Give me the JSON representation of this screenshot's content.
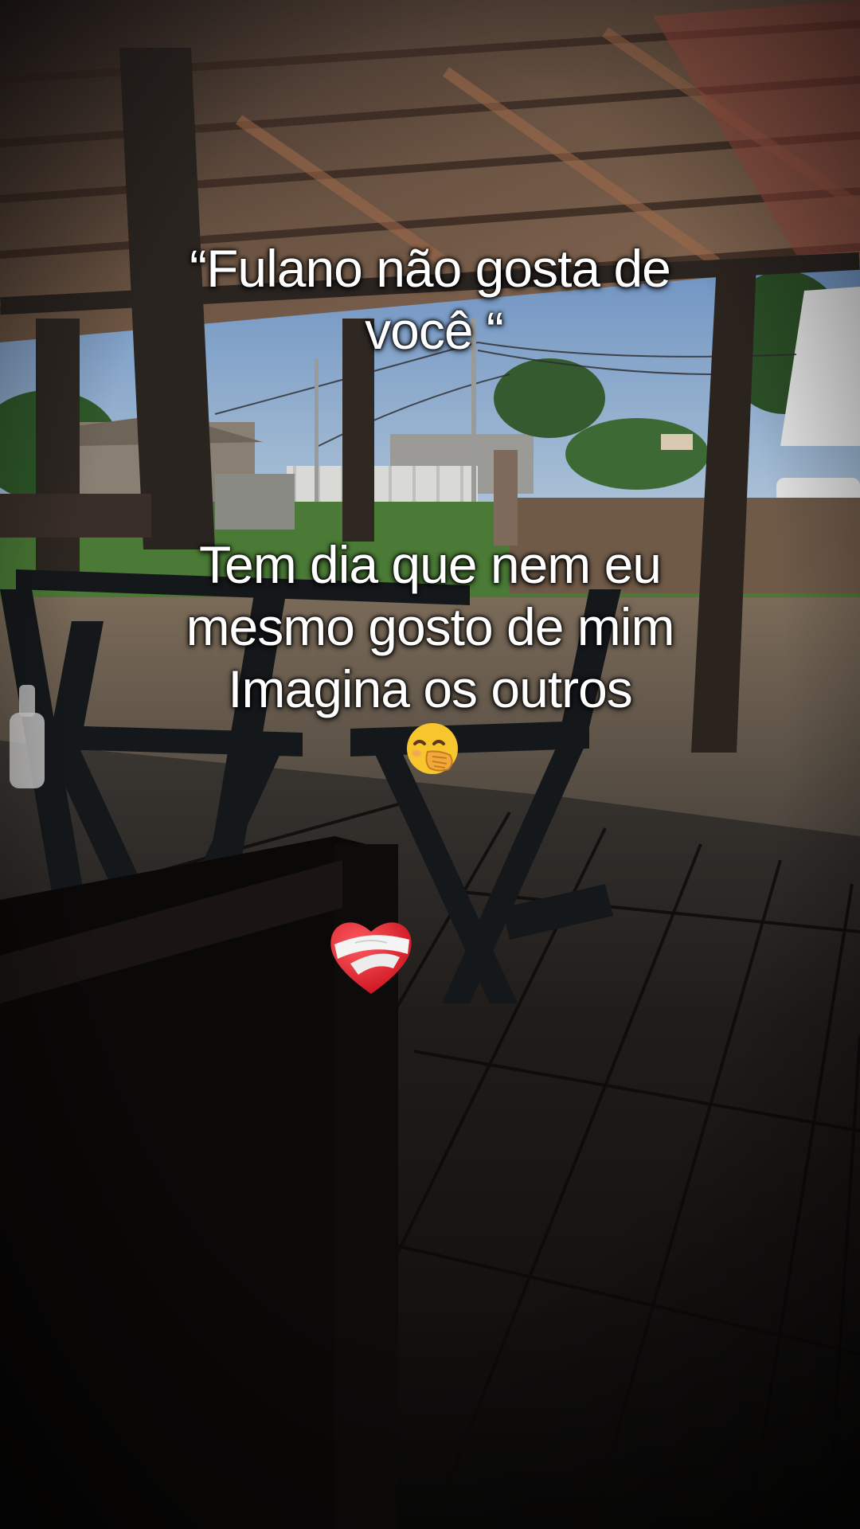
{
  "caption": {
    "quote_line1": "“Fulano não gosta de",
    "quote_line2": "você “",
    "body_line1": "Tem dia que nem eu",
    "body_line2": "mesmo gosto de mim",
    "body_line3": "Imagina os outros"
  },
  "icons": {
    "hand_over_mouth": "face-with-hand-over-mouth-emoji",
    "bandaged_heart": "mending-heart-emoji"
  },
  "colors": {
    "sky": "#7f9fc6",
    "roof_wood": "#6a4e3c",
    "deck": "#1b1714",
    "chair": "#14171a",
    "heart_red": "#e0141f"
  }
}
